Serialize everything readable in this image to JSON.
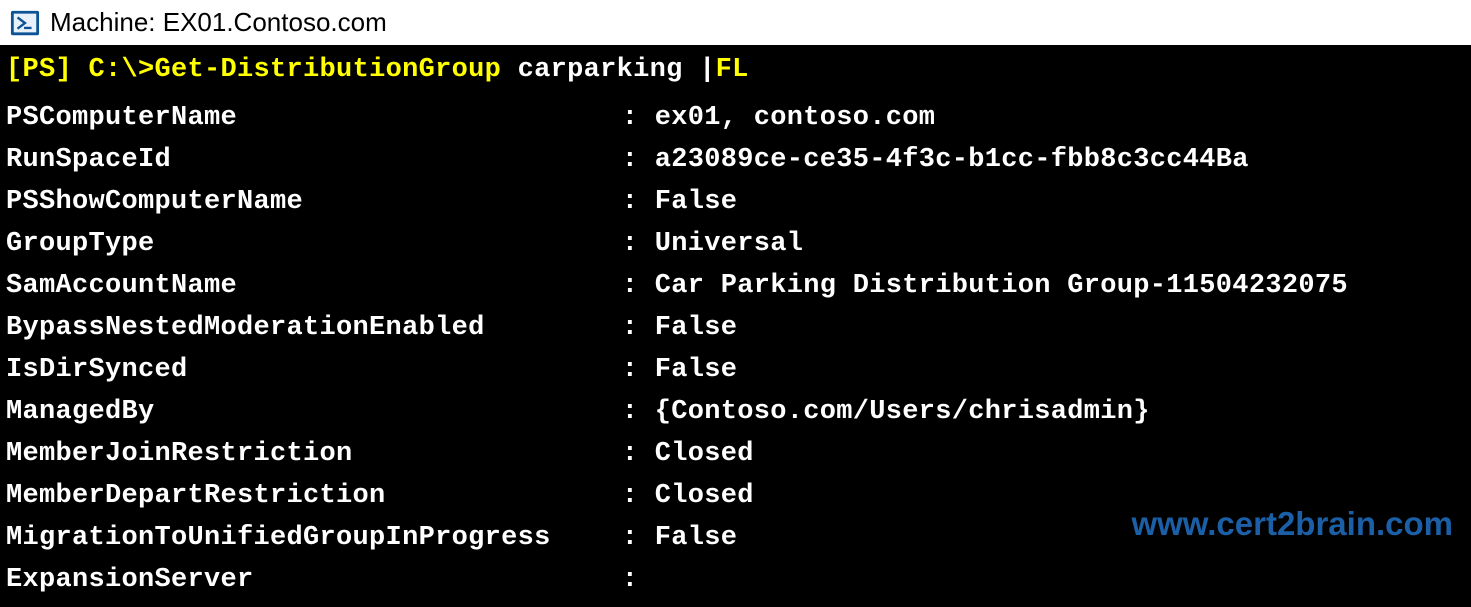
{
  "titlebar": {
    "prefix": "Machine: ",
    "host": "EX01.Contoso.com"
  },
  "prompt": {
    "ps": "[PS] ",
    "path": "C:\\>",
    "cmd1": "Get-DistributionGroup ",
    "argmid": "carparking ",
    "pipe": "|",
    "cmd2": "FL"
  },
  "output": {
    "cols": {
      "sep": ":"
    },
    "rows": [
      {
        "label": "PSComputerName",
        "value": "ex01, contoso.com"
      },
      {
        "label": "RunSpaceId",
        "value": "a23089ce-ce35-4f3c-b1cc-fbb8c3cc44Ba"
      },
      {
        "label": "PSShowComputerName",
        "value": "False"
      },
      {
        "label": "GroupType",
        "value": "Universal"
      },
      {
        "label": "SamAccountName",
        "value": "Car Parking Distribution Group-11504232075"
      },
      {
        "label": "BypassNestedModerationEnabled",
        "value": "False"
      },
      {
        "label": "IsDirSynced",
        "value": "False"
      },
      {
        "label": "ManagedBy",
        "value": "{Contoso.com/Users/chrisadmin}"
      },
      {
        "label": "MemberJoinRestriction",
        "value": "Closed"
      },
      {
        "label": "MemberDepartRestriction",
        "value": "Closed"
      },
      {
        "label": "MigrationToUnifiedGroupInProgress",
        "value": "False"
      },
      {
        "label": "ExpansionServer",
        "value": ""
      }
    ]
  },
  "watermark": {
    "text": "www.cert2brain.com"
  }
}
